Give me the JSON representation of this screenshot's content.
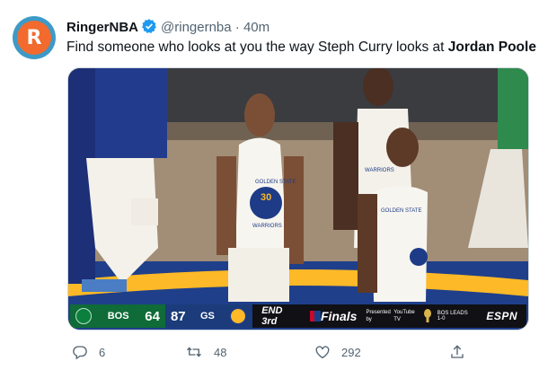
{
  "tweet": {
    "display_name": "RingerNBA",
    "handle": "@ringernba",
    "separator": "·",
    "time": "40m",
    "text_prefix": "Find someone who looks at you the way Steph Curry looks at ",
    "text_bold": "Jordan Poole",
    "avatar_letter": "R"
  },
  "scorebug": {
    "away_team": "BOS",
    "away_score": "64",
    "home_score": "87",
    "home_team": "GS",
    "period": "END 3rd",
    "finals": "Finals",
    "presented": "Presented by",
    "sponsor": "YouTube TV",
    "series_status": "BOS LEADS 1-0",
    "network": "ESPN"
  },
  "jerseys": {
    "curry_brand": "GOLDEN STATE",
    "curry_number": "30",
    "curry_team": "WARRIORS",
    "poole_brand": "GOLDEN STATE",
    "back_team": "WARRIORS"
  },
  "actions": {
    "replies": "6",
    "retweets": "48",
    "likes": "292"
  },
  "colors": {
    "avatar_ring": "#3d9ac7",
    "avatar_fill": "#f26a2d",
    "verified": "#1d9bf0",
    "bos_green": "#0f6b38",
    "gs_blue": "#1b3b7a",
    "gs_gold": "#fdb927"
  },
  "icons": [
    "verified-badge-icon",
    "reply-icon",
    "retweet-icon",
    "like-icon",
    "more-icon"
  ]
}
